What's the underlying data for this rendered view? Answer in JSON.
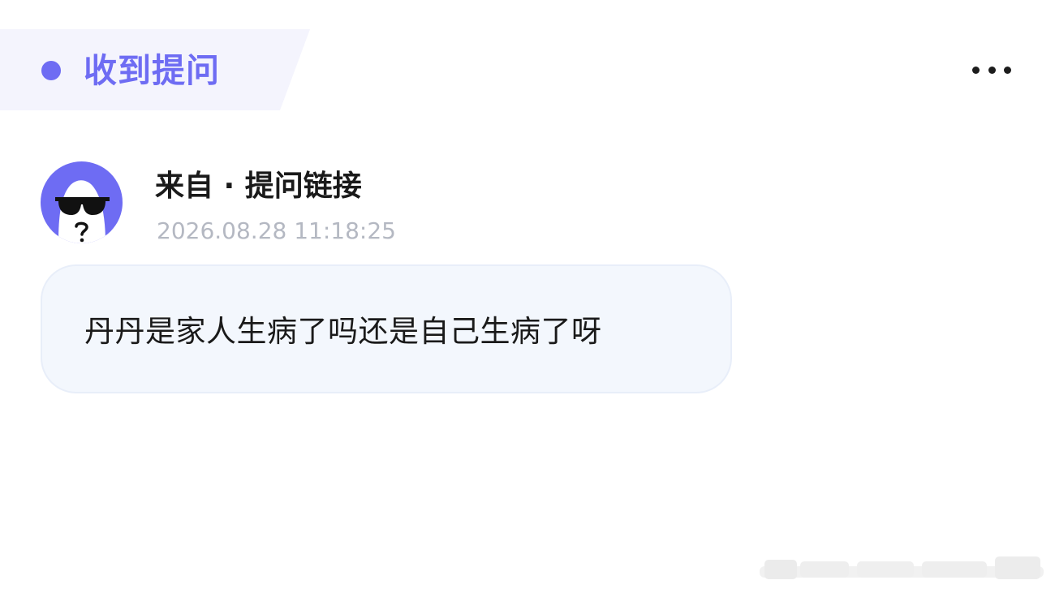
{
  "header": {
    "title": "收到提问",
    "accent_color": "#6e6cf3",
    "more_icon": "more-horizontal-icon"
  },
  "sender": {
    "avatar_icon": "anonymous-sunglasses-avatar",
    "name": "来自 · 提问链接",
    "timestamp": "2026.08.28 11:18:25"
  },
  "question": {
    "text": "丹丹是家人生病了吗还是自己生病了呀"
  }
}
